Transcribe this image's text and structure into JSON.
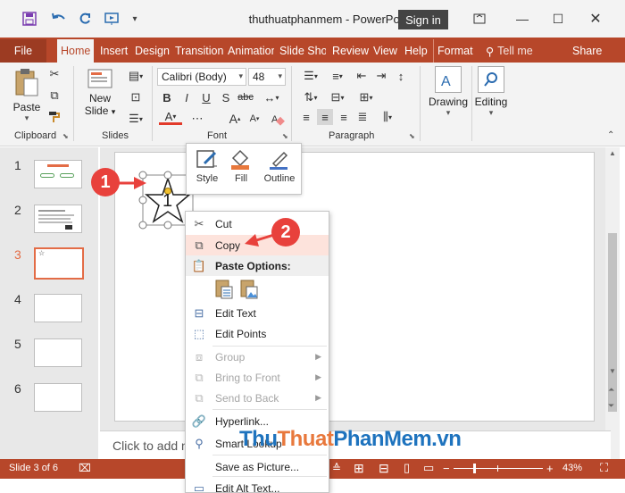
{
  "app": {
    "title": "thuthuatphanmem  -  PowerPoint",
    "sign_in": "Sign in",
    "accent": "#b7472a"
  },
  "quick_access": {
    "save_icon": "save-icon",
    "undo_icon": "undo-icon",
    "redo_icon": "redo-icon",
    "present_icon": "start-from-beginning-icon"
  },
  "tabs": [
    "File",
    "Home",
    "Insert",
    "Design",
    "Transition",
    "Animation",
    "Slide Show",
    "Review",
    "View",
    "Help",
    "Format"
  ],
  "active_tab": "Home",
  "tell_me": "Tell me",
  "share": "Share",
  "ribbon": {
    "clipboard": {
      "paste": "Paste",
      "label": "Clipboard"
    },
    "slides": {
      "new_slide_1": "New",
      "new_slide_2": "Slide",
      "label": "Slides"
    },
    "font": {
      "font_name": "Calibri (Body)",
      "font_size": "48",
      "label": "Font",
      "bold": "B",
      "italic": "I",
      "underline": "U",
      "strike": "S",
      "spacing": "abc",
      "font_color": "A",
      "grow": "A",
      "shrink": "A",
      "clear": "A"
    },
    "paragraph": {
      "label": "Paragraph"
    },
    "drawing": {
      "label": "Drawing"
    },
    "editing": {
      "label": "Editing"
    }
  },
  "thumbnails": [
    {
      "num": "1"
    },
    {
      "num": "2"
    },
    {
      "num": "3"
    },
    {
      "num": "4"
    },
    {
      "num": "5"
    },
    {
      "num": "6"
    }
  ],
  "mini_toolbar": {
    "style": "Style",
    "fill": "Fill",
    "outline": "Outline",
    "fill_color": "#e8783c",
    "outline_color": "#4472c4"
  },
  "shape": {
    "text": "1"
  },
  "context_menu": {
    "cut": "Cut",
    "copy": "Copy",
    "paste_options": "Paste Options:",
    "edit_text": "Edit Text",
    "edit_points": "Edit Points",
    "group": "Group",
    "bring_to_front": "Bring to Front",
    "send_to_back": "Send to Back",
    "hyperlink": "Hyperlink...",
    "smart_lookup": "Smart Lookup",
    "save_as_picture": "Save as Picture...",
    "edit_alt_text": "Edit Alt Text..."
  },
  "callouts": {
    "one": "1",
    "two": "2"
  },
  "notes_placeholder": "Click to add n",
  "status": {
    "slide_of": "Slide 3 of 6",
    "zoom": "43%",
    "minus": "−",
    "plus": "+"
  },
  "watermark": {
    "part1": "Thu",
    "part2": "Thuat",
    "part3": "PhanMem",
    "part4": ".vn",
    "color_blue": "#1e73be",
    "color_orange": "#e8783c"
  }
}
